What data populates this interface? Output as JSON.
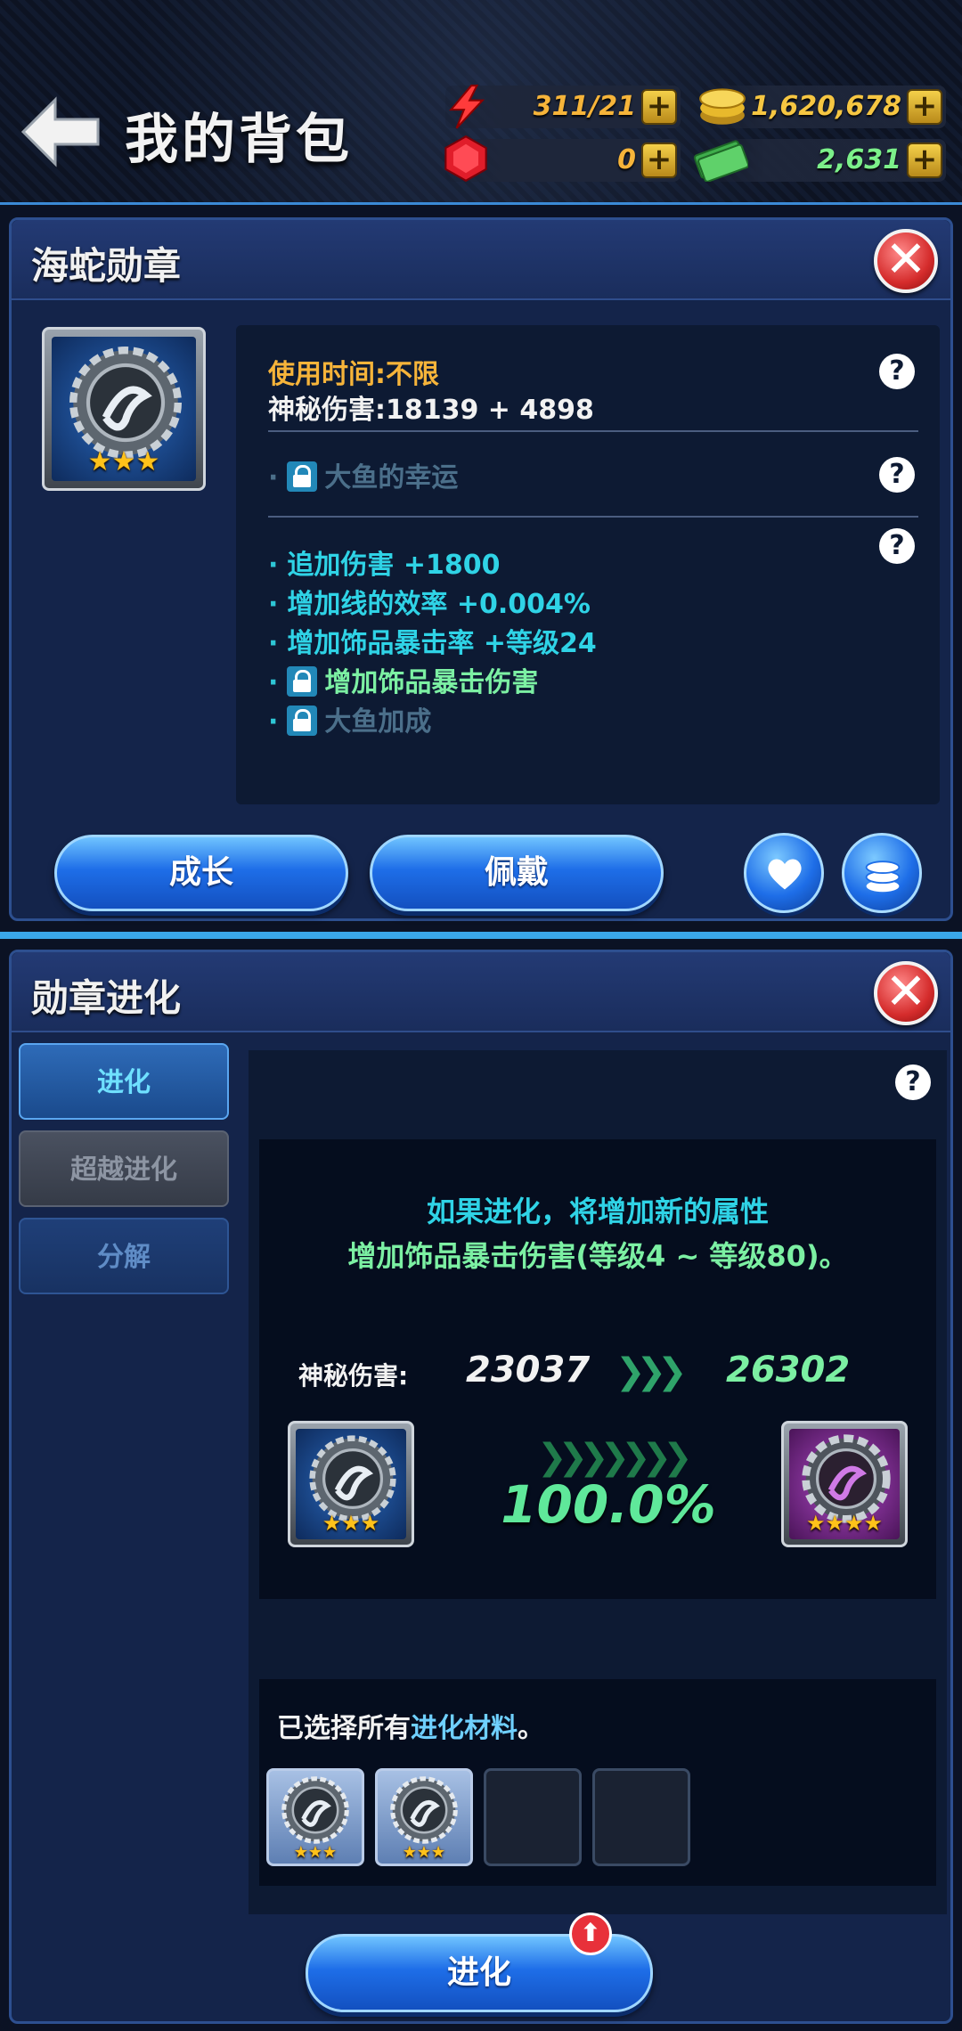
{
  "header": {
    "title": "我的背包",
    "energy": "311/21",
    "gold": "1,620,678",
    "gems": "0",
    "cash": "2,631"
  },
  "medal_panel": {
    "title": "海蛇勋章",
    "stars": "★★★",
    "usage_time": "使用时间:不限",
    "mystic_damage": "神秘伤害:18139 + 4898",
    "locked_skill": "大鱼的幸运",
    "bonus_stats": [
      "追加伤害 +1800",
      "增加线的效率 +0.004%",
      "增加饰品暴击率 +等级24"
    ],
    "locked_stats": [
      "增加饰品暴击伤害",
      "大鱼加成"
    ],
    "buttons": {
      "grow": "成长",
      "equip": "佩戴"
    }
  },
  "evo_panel": {
    "title": "勋章进化",
    "tabs": [
      "进化",
      "超越进化",
      "分解"
    ],
    "message_line1": "如果进化，将增加新的属性",
    "message_line2": "增加饰品暴击伤害(等级4 ~ 等级80)。",
    "stat_label": "神秘伤害:",
    "stat_before": "23037",
    "stat_after": "26302",
    "success_rate": "100.0%",
    "medal_before_stars": "★★★",
    "medal_after_stars": "★★★★",
    "materials_prefix": "已选择所有",
    "materials_link": "进化材料",
    "materials_suffix": "。",
    "material_slots": [
      {
        "filled": true,
        "stars": "★★★"
      },
      {
        "filled": true,
        "stars": "★★★"
      },
      {
        "filled": false
      },
      {
        "filled": false
      }
    ],
    "evolve_button": "进化"
  },
  "colors": {
    "gold_text": "#f6b43a",
    "cyan_text": "#2fd3e6",
    "green_text": "#7cf0a3",
    "locked_text": "#4b6f8a",
    "accent_blue": "#1e6ee8"
  },
  "icons": [
    "back-arrow-icon",
    "lightning-icon",
    "gold-coin-icon",
    "ruby-icon",
    "cash-icon",
    "plus-icon",
    "close-icon",
    "help-icon",
    "lock-icon",
    "heart-icon",
    "coin-stack-icon",
    "sea-serpent-medal-icon",
    "up-arrow-icon",
    "chevron-icon"
  ]
}
